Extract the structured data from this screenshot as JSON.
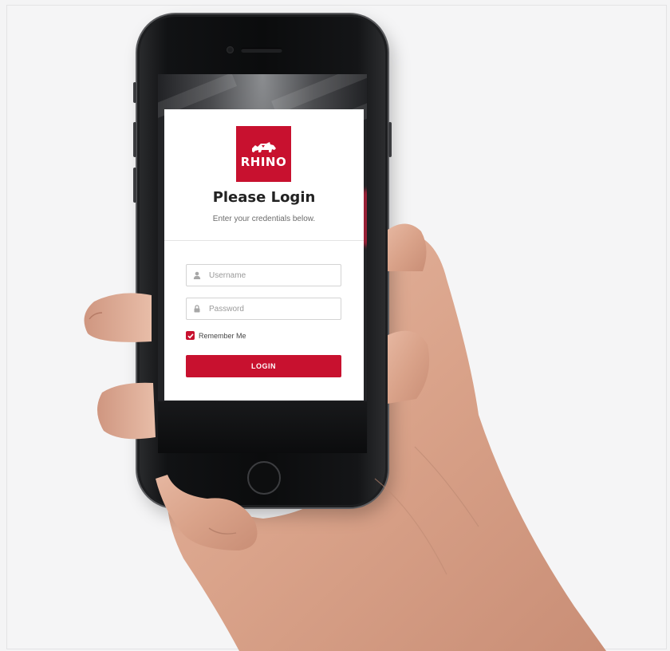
{
  "logo": {
    "text": "RHINO",
    "icon": "rhino-icon",
    "color": "#c8112f"
  },
  "login": {
    "title": "Please Login",
    "subtitle": "Enter your credentials below.",
    "username": {
      "placeholder": "Username",
      "value": "",
      "icon": "user-icon"
    },
    "password": {
      "placeholder": "Password",
      "value": "",
      "icon": "lock-icon"
    },
    "remember": {
      "label": "Remember Me",
      "checked": true
    },
    "submit_label": "LOGIN"
  },
  "colors": {
    "accent": "#c8112f",
    "background": "#f4f4f5",
    "card": "#ffffff"
  }
}
